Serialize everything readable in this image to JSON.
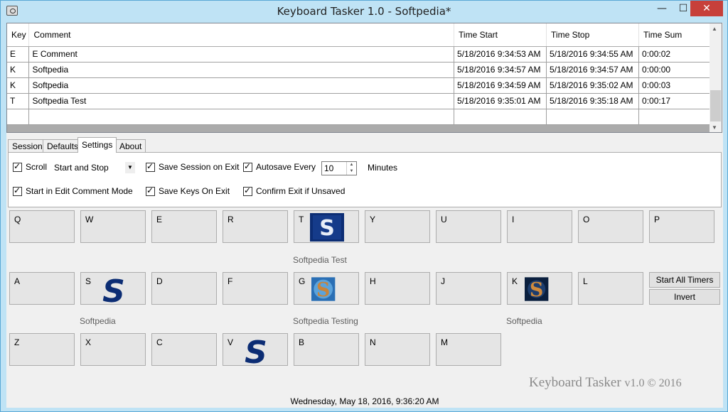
{
  "window": {
    "title": "Keyboard Tasker 1.0 - Softpedia*",
    "min": "—",
    "max": "☐",
    "close": "✕"
  },
  "grid": {
    "columns": [
      "Key",
      "Comment",
      "Time Start",
      "Time Stop",
      "Time Sum"
    ],
    "rows": [
      [
        "E",
        "E Comment",
        "5/18/2016 9:34:53 AM",
        "5/18/2016 9:34:55 AM",
        "0:00:02"
      ],
      [
        "K",
        "Softpedia",
        "5/18/2016 9:34:57 AM",
        "5/18/2016 9:34:57 AM",
        "0:00:00"
      ],
      [
        "K",
        "Softpedia",
        "5/18/2016 9:34:59 AM",
        "5/18/2016 9:35:02 AM",
        "0:00:03"
      ],
      [
        "T",
        "Softpedia Test",
        "5/18/2016 9:35:01 AM",
        "5/18/2016 9:35:18 AM",
        "0:00:17"
      ]
    ]
  },
  "tabs": [
    {
      "label": "Session"
    },
    {
      "label": "Defaults"
    },
    {
      "label": "Settings"
    },
    {
      "label": "About"
    }
  ],
  "settings": {
    "scroll": "Scroll",
    "scroll_mode": "Start and Stop",
    "save_session": "Save Session on Exit",
    "autosave": "Autosave Every",
    "autosave_value": "10",
    "minutes": "Minutes",
    "edit_mode": "Start in Edit Comment Mode",
    "save_keys": "Save Keys On Exit",
    "confirm_exit": "Confirm Exit if Unsaved"
  },
  "keys": {
    "row1": [
      "Q",
      "W",
      "E",
      "R",
      "T",
      "Y",
      "U",
      "I",
      "O",
      "P"
    ],
    "row2": [
      "A",
      "S",
      "D",
      "F",
      "G",
      "H",
      "J",
      "K",
      "L"
    ],
    "row3": [
      "Z",
      "X",
      "C",
      "V",
      "B",
      "N",
      "M"
    ]
  },
  "captions": {
    "t": "Softpedia Test",
    "s": "Softpedia",
    "g": "Softpedia Testing",
    "k": "Softpedia"
  },
  "buttons": {
    "start_all": "Start All Timers",
    "invert": "Invert"
  },
  "brand": {
    "name": "Keyboard Tasker",
    "version": "v1.0 © 2016"
  },
  "status": "Wednesday, May 18, 2016, 9:36:20 AM",
  "colors": {
    "accent": "#bfe3f5",
    "close": "#c7403a",
    "logo_blue": "#0c2d74"
  }
}
